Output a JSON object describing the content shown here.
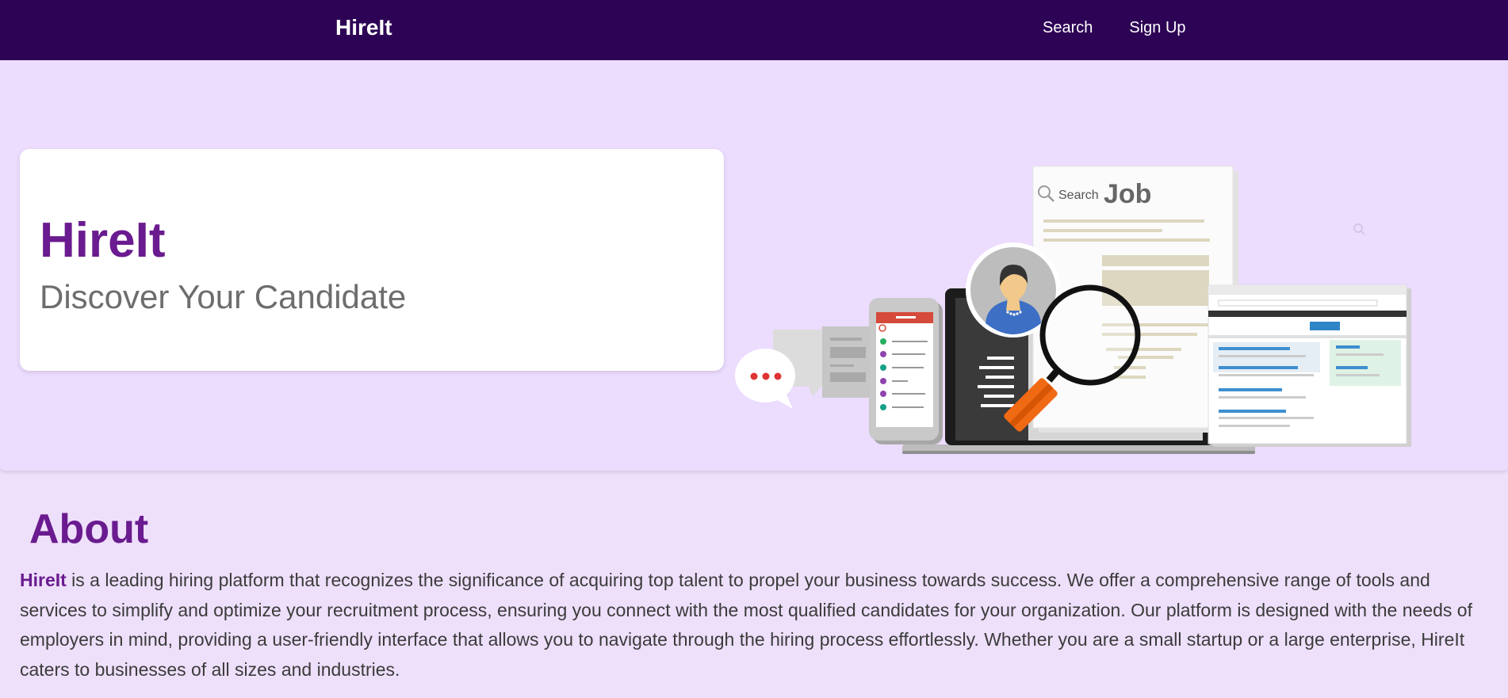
{
  "navbar": {
    "brand": "HireIt",
    "links": [
      {
        "label": "Search"
      },
      {
        "label": "Sign Up"
      }
    ]
  },
  "hero": {
    "title": "HireIt",
    "subtitle": "Discover Your Candidate",
    "illustration": {
      "search_label": "Search",
      "job_label": "Job"
    }
  },
  "about": {
    "heading": "About",
    "brand": "HireIt",
    "text": " is a leading hiring platform that recognizes the significance of acquiring top talent to propel your business towards success. We offer a comprehensive range of tools and services to simplify and optimize your recruitment process, ensuring you connect with the most qualified candidates for your organization. Our platform is designed with the needs of employers in mind, providing a user-friendly interface that allows you to navigate through the hiring process effortlessly. Whether you are a small startup or a large enterprise, HireIt caters to businesses of all sizes and industries."
  },
  "colors": {
    "navbar_bg": "#2d0455",
    "accent": "#6a1b8f",
    "page_bg": "#eee0fb",
    "hero_bg": "#ecdcfe"
  }
}
